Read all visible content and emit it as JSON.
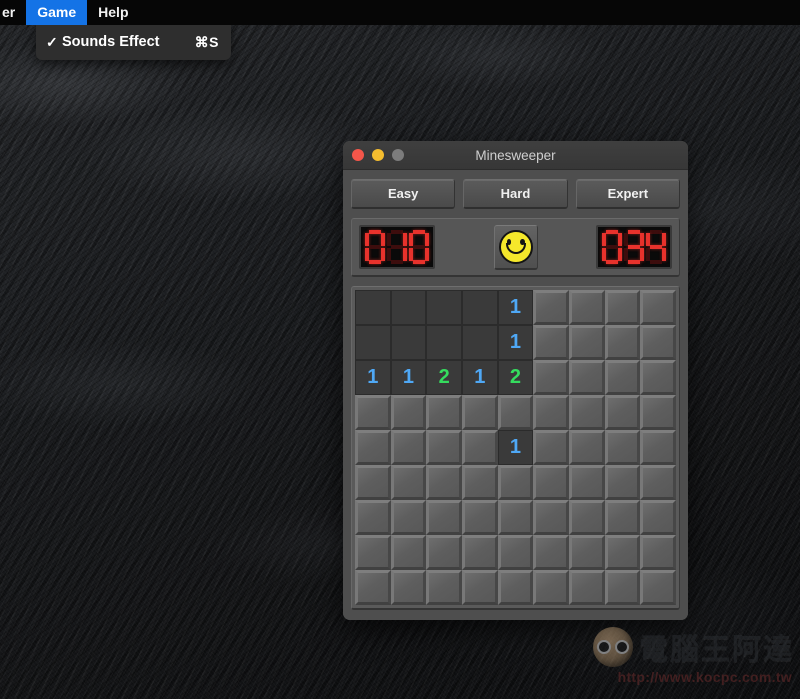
{
  "menubar": {
    "items": [
      {
        "label": "er",
        "active": false,
        "clipped": true
      },
      {
        "label": "Game",
        "active": true,
        "clipped": false
      },
      {
        "label": "Help",
        "active": false,
        "clipped": false
      }
    ],
    "active_color": "#1473e6",
    "background": "#060606"
  },
  "dropdown": {
    "owner": "Game",
    "rows": [
      {
        "check": "✓",
        "label": "Sounds Effect",
        "shortcut": "⌘S"
      }
    ]
  },
  "window": {
    "title": "Minesweeper",
    "traffic_lights": [
      {
        "name": "close",
        "color": "#f4564a"
      },
      {
        "name": "minimize",
        "color": "#f5bd2f"
      },
      {
        "name": "zoom",
        "color": "#7c7c7c"
      }
    ]
  },
  "difficulty": {
    "buttons": [
      {
        "label": "Easy"
      },
      {
        "label": "Hard"
      },
      {
        "label": "Expert"
      }
    ]
  },
  "status": {
    "mine_counter": "010",
    "timer": "034",
    "smiley_state": "smile",
    "led_on_color": "#e8322c",
    "led_off_color": "#3d0d0d"
  },
  "board": {
    "rows": 9,
    "cols": 9,
    "number_colors": {
      "1": "#4fa8f5",
      "2": "#35dc5e"
    },
    "cells": [
      [
        "hidden",
        "hidden",
        "hidden",
        "hidden",
        "1",
        "hidden",
        "hidden",
        "hidden",
        "hidden"
      ],
      [
        "hidden",
        "hidden",
        "hidden",
        "hidden",
        "1",
        "hidden",
        "hidden",
        "hidden",
        "hidden"
      ],
      [
        "1",
        "1",
        "2",
        "1",
        "2",
        "hidden",
        "hidden",
        "hidden",
        "hidden"
      ],
      [
        "hidden",
        "hidden",
        "hidden",
        "hidden",
        "hidden",
        "hidden",
        "hidden",
        "hidden",
        "hidden"
      ],
      [
        "hidden",
        "hidden",
        "hidden",
        "hidden",
        "1",
        "hidden",
        "hidden",
        "hidden",
        "hidden"
      ],
      [
        "hidden",
        "hidden",
        "hidden",
        "hidden",
        "hidden",
        "hidden",
        "hidden",
        "hidden",
        "hidden"
      ],
      [
        "hidden",
        "hidden",
        "hidden",
        "hidden",
        "hidden",
        "hidden",
        "hidden",
        "hidden",
        "hidden"
      ],
      [
        "hidden",
        "hidden",
        "hidden",
        "hidden",
        "hidden",
        "hidden",
        "hidden",
        "hidden",
        "hidden"
      ],
      [
        "hidden",
        "hidden",
        "hidden",
        "hidden",
        "hidden",
        "hidden",
        "hidden",
        "hidden",
        "hidden"
      ]
    ],
    "revealed_blank_cells": [
      [
        0,
        0
      ],
      [
        0,
        1
      ],
      [
        0,
        2
      ],
      [
        0,
        3
      ],
      [
        1,
        0
      ],
      [
        1,
        1
      ],
      [
        1,
        2
      ],
      [
        1,
        3
      ]
    ]
  },
  "watermark": {
    "chinese": "電腦王阿達",
    "url": "http://www.kocpc.com.tw"
  }
}
